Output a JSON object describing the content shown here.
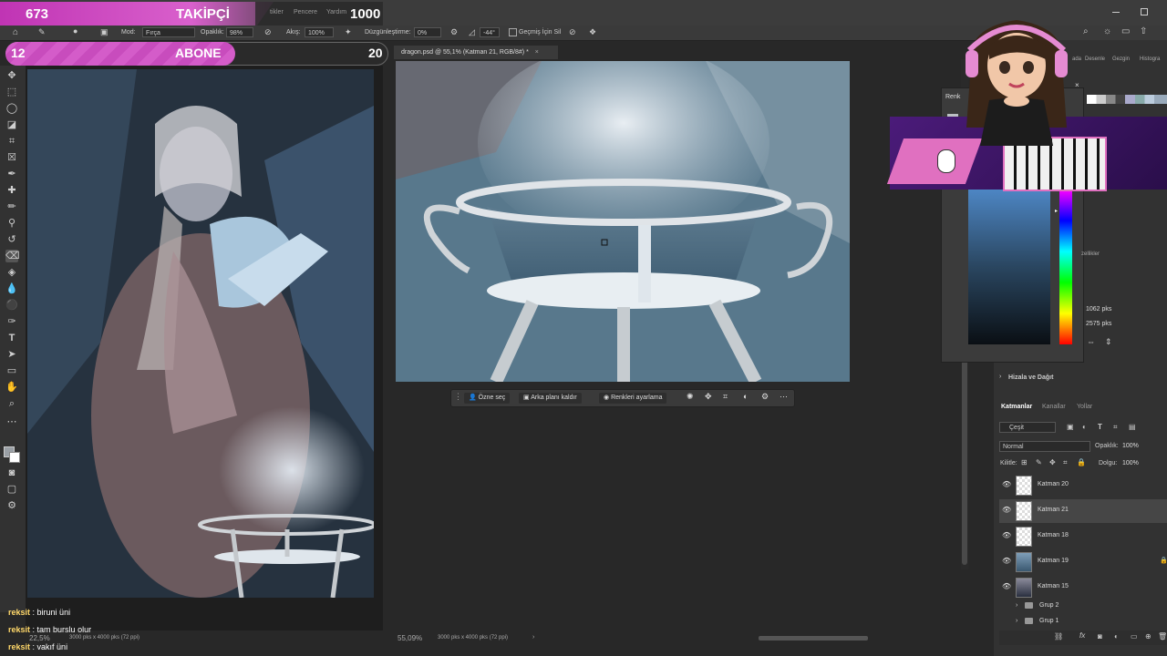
{
  "stream": {
    "followers_count": "673",
    "followers_label": "TAKİPÇİ",
    "followers_goal": "1000",
    "subs_count": "12",
    "subs_label": "ABONE",
    "subs_goal": "20",
    "subs_progress": 0.6,
    "accent_color": "#d45cc9"
  },
  "menubar": {
    "items": [
      "tikler",
      "Pencere",
      "Yardım"
    ]
  },
  "options": {
    "mode_label": "Mod:",
    "mode_value": "Fırça",
    "opacity_label": "Opaklık:",
    "opacity_value": "98%",
    "flow_label": "Akış:",
    "flow_value": "100%",
    "smoothing_label": "Düzgünleştirme:",
    "smoothing_value": "0%",
    "angle_value": "-44°",
    "history_label": "Geçmiş İçin Sil"
  },
  "document": {
    "tab_title": "dragon.psd @ 55,1% (Katman 21, RGB/8#) *",
    "zoom": "55,09%",
    "size_info": "3000 pks x 4000 pks (72 ppi)"
  },
  "left_doc": {
    "zoom": "22,5%",
    "size_info": "3000 pks x 4000 pks (72 ppi)"
  },
  "context_bar": {
    "subject": "Özne seç",
    "remove_bg": "Arka planı kaldır",
    "adjust": "Renkleri ayarlama"
  },
  "right_panel": {
    "tabs_top": [
      "ada",
      "Desenle",
      "Gezgin",
      "Histogra"
    ],
    "color_tab": "Renk",
    "width_value": "1062 pks",
    "height_value": "2575 pks",
    "props_label": "zellikler",
    "align_label": "Hizala ve Dağıt",
    "layer_tabs": [
      "Katmanlar",
      "Kanallar",
      "Yollar"
    ],
    "filter_label": "Çeşit",
    "blend_mode": "Normal",
    "opacity_label": "Opaklık:",
    "opacity_value": "100%",
    "lock_label": "Kilitle:",
    "fill_label": "Dolgu:",
    "fill_value": "100%"
  },
  "layers": [
    {
      "name": "Katman 20",
      "selected": false
    },
    {
      "name": "Katman 21",
      "selected": true
    },
    {
      "name": "Katman 18",
      "selected": false
    },
    {
      "name": "Katman 19",
      "selected": false
    },
    {
      "name": "Katman 15",
      "selected": false
    },
    {
      "name": "Grup 2",
      "selected": false
    },
    {
      "name": "Grup 1",
      "selected": false
    }
  ],
  "chat": [
    {
      "user": "reksit",
      "message": ": biruni üni"
    },
    {
      "user": "reksit",
      "message": ": tam burslu olur"
    },
    {
      "user": "reksit",
      "message": ": vakıf üni"
    }
  ]
}
